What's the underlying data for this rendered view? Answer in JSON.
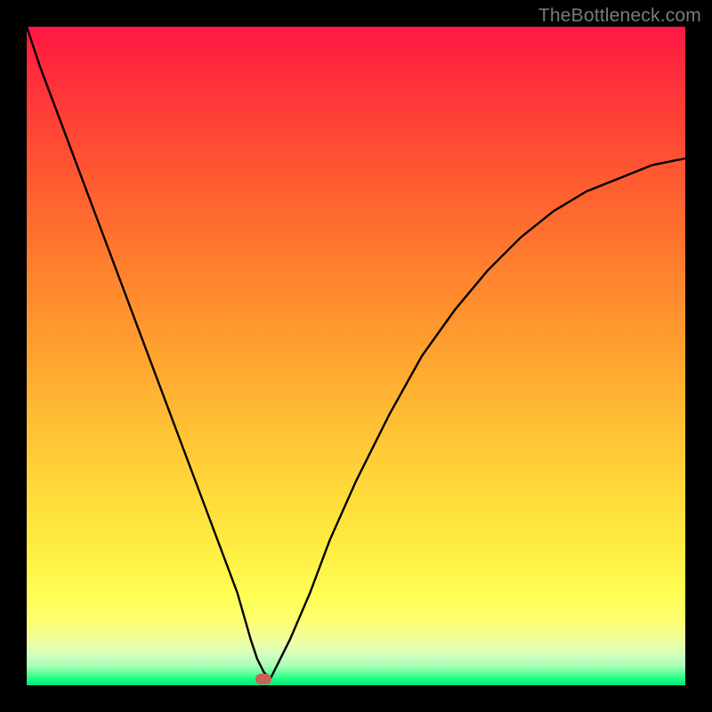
{
  "watermark": "TheBottleneck.com",
  "chart_data": {
    "type": "line",
    "title": "",
    "xlabel": "",
    "ylabel": "",
    "xlim": [
      0,
      100
    ],
    "ylim": [
      0,
      100
    ],
    "grid": false,
    "legend": false,
    "background_gradient": {
      "top": "#ff1744",
      "mid": "#ffee33",
      "bottom": "#00e676"
    },
    "series": [
      {
        "name": "bottleneck-curve",
        "color": "#000000",
        "x": [
          0,
          2,
          5,
          8,
          11,
          14,
          17,
          20,
          23,
          26,
          29,
          32,
          34,
          35,
          36,
          37,
          38,
          40,
          43,
          46,
          50,
          55,
          60,
          65,
          70,
          75,
          80,
          85,
          90,
          95,
          100
        ],
        "y": [
          100,
          94,
          86,
          78,
          70,
          62,
          54,
          46,
          38,
          30,
          22,
          14,
          7,
          4,
          2,
          1,
          3,
          7,
          14,
          22,
          31,
          41,
          50,
          57,
          63,
          68,
          72,
          75,
          77,
          79,
          80
        ]
      }
    ],
    "marker": {
      "name": "optimal-point",
      "x": 36,
      "y": 1,
      "color": "#c96056"
    }
  }
}
